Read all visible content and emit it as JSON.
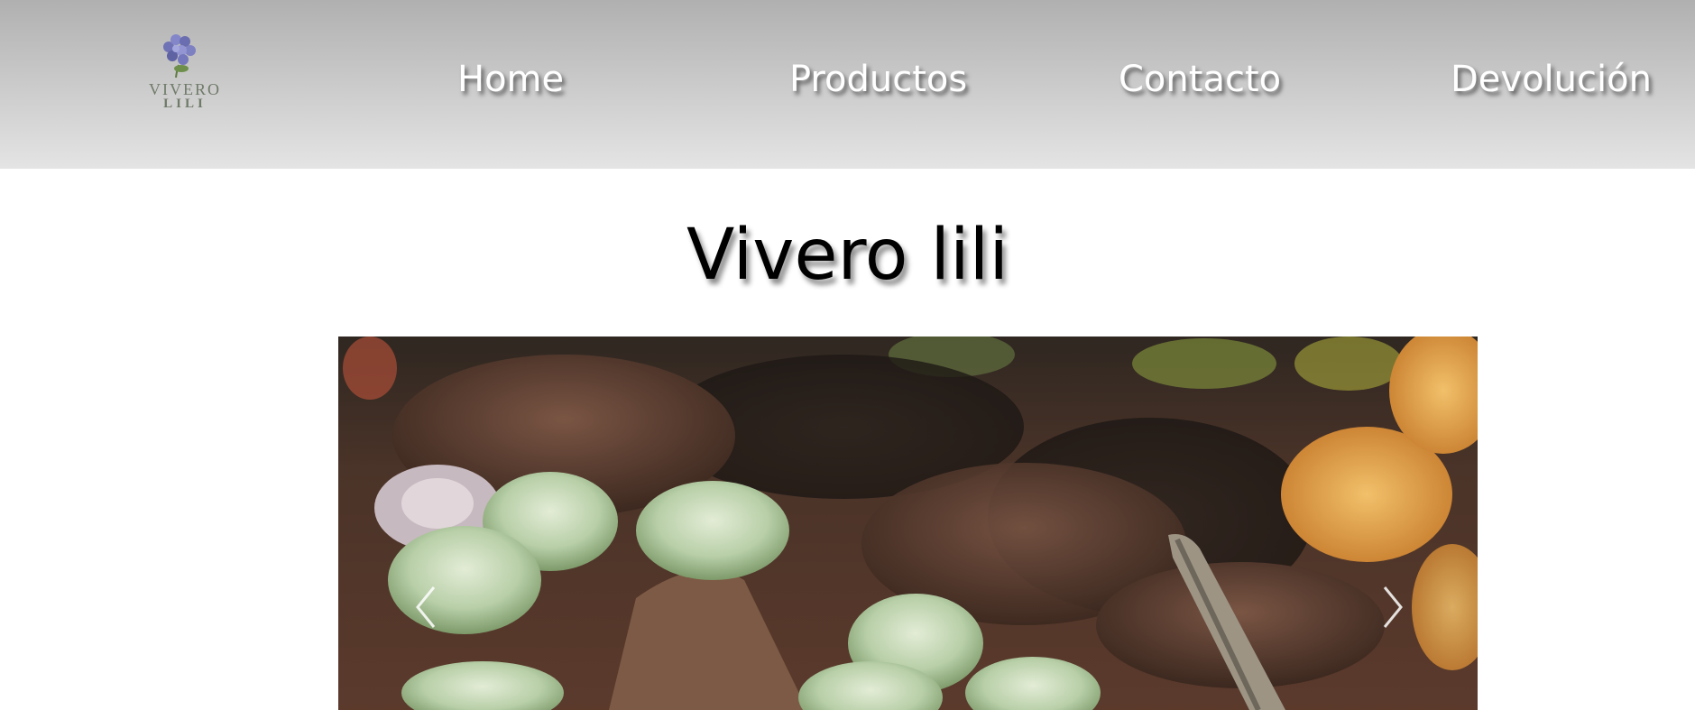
{
  "logo": {
    "line1": "VIVERO",
    "line2": "LILI",
    "icon": "hydrangea-flower-icon"
  },
  "nav": {
    "items": [
      {
        "label": "Home"
      },
      {
        "label": "Productos"
      },
      {
        "label": "Contacto"
      },
      {
        "label": "Devolución"
      }
    ]
  },
  "main": {
    "title": "Vivero lili"
  },
  "carousel": {
    "image": "succulents-garden-photo",
    "prev_icon": "chevron-left-icon",
    "next_icon": "chevron-right-icon"
  },
  "colors": {
    "nav_text": "#ffffff",
    "logo_text": "#6f7a69",
    "title_text": "#000000"
  }
}
